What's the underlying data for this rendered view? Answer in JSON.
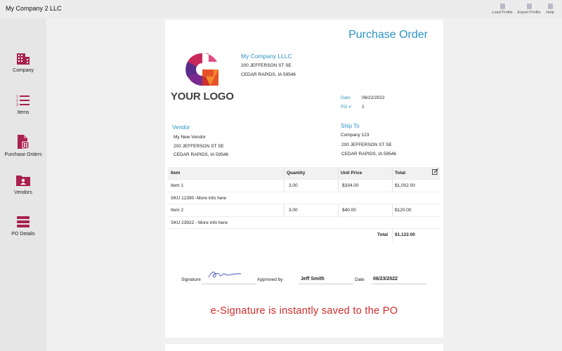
{
  "app": {
    "title": "My Company 2 LLC",
    "toolbar": {
      "load_profile": "Load Profile",
      "export_profile": "Export Profile",
      "help": "Help"
    }
  },
  "sidebar": {
    "items": [
      {
        "label": "Company",
        "icon": "company-building-icon"
      },
      {
        "label": "Items",
        "icon": "numbered-list-icon"
      },
      {
        "label": "Purchase Orders",
        "icon": "document-icon"
      },
      {
        "label": "Vendors",
        "icon": "vendor-folder-icon"
      },
      {
        "label": "PO Details",
        "icon": "po-details-icon"
      }
    ],
    "accent_color": "#a8214f"
  },
  "document": {
    "title": "Purchase Order",
    "logo_text": "YOUR LOGO",
    "company": {
      "name": "My Company LLLC",
      "address1": "200 JEFFERSON ST SE",
      "address2": "CEDAR RAPIDS, IA 59546"
    },
    "meta": {
      "date_label": "Date",
      "date_value": "06/22/2022",
      "po_label": "PO #",
      "po_value": "1"
    },
    "vendor": {
      "heading": "Vendor",
      "name": "My New Vendor",
      "address1": "200 JEFFERSON ST SE",
      "address2": "CEDAR RAPIDS, IA 59546"
    },
    "ship_to": {
      "heading": "Ship To",
      "name": "Company 123",
      "address1": "200 JEFFERSON ST SE",
      "address2": "CEDAR RAPIDS, IA 59546"
    },
    "table": {
      "headers": {
        "item": "Item",
        "quantity": "Quantity",
        "unit_price": "Unit Price",
        "total": "Total"
      },
      "rows": [
        {
          "item": "Item 1",
          "quantity": "3.00",
          "unit_price": "$334.00",
          "total": "$1,002.00",
          "detail": "SKU 12390 -More info here"
        },
        {
          "item": "Item 2",
          "quantity": "3.00",
          "unit_price": "$40.00",
          "total": "$120.00",
          "detail": "SKU 23922 - More info here"
        }
      ],
      "total_label": "Total",
      "total_value": "$1,122.00"
    },
    "signature": {
      "signature_label": "Signature",
      "approved_by_label": "Approved by",
      "approved_by_value": "Jeff Smith",
      "date_label": "Date",
      "date_value": "06/23/2022"
    },
    "promo_text": "e-Signature is instantly saved to the PO",
    "colors": {
      "link_blue": "#2a93c6",
      "promo_red": "#d62a2a"
    }
  }
}
